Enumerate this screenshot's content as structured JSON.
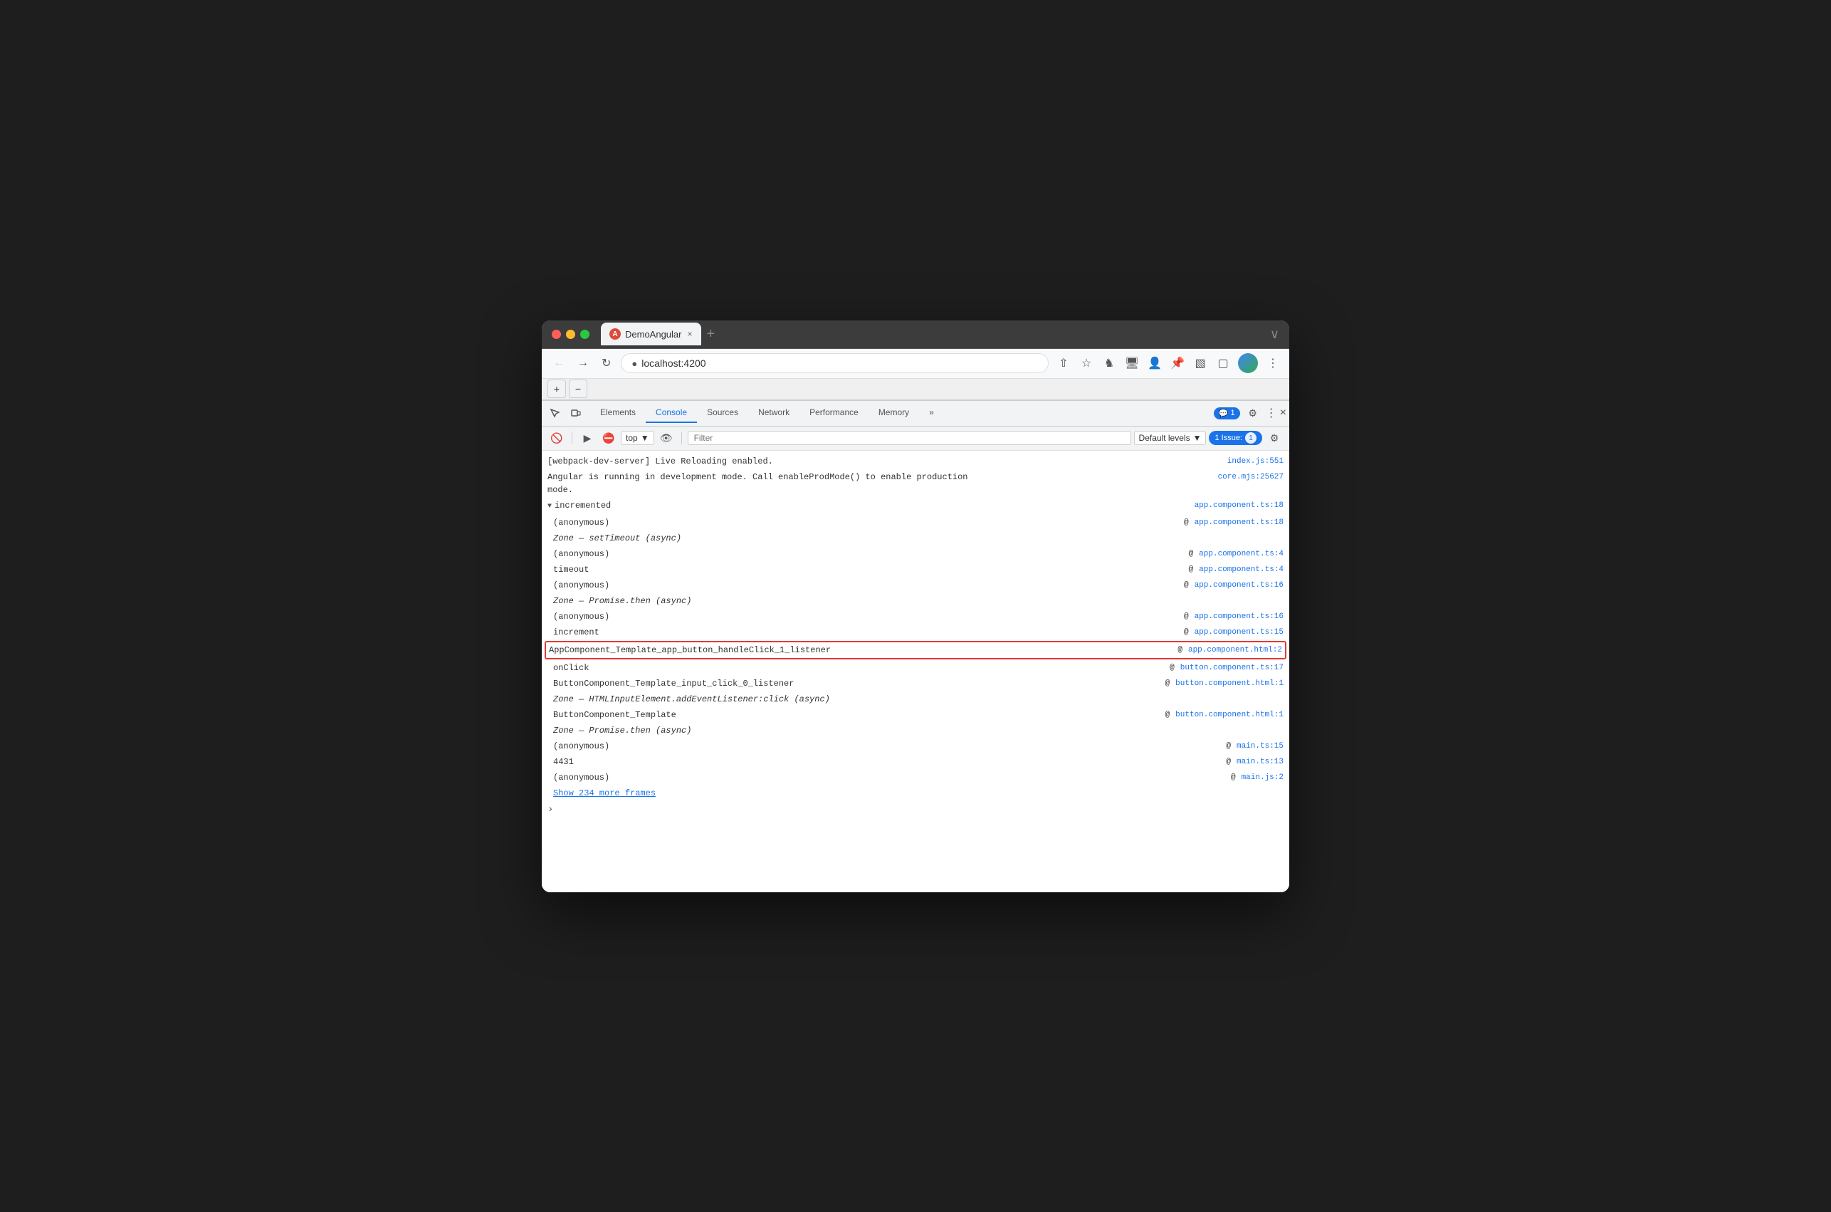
{
  "browser": {
    "tab_title": "DemoAngular",
    "tab_close": "×",
    "tab_new": "+",
    "address": "localhost:4200",
    "window_expand": "∨"
  },
  "devtools": {
    "tabs": [
      "Elements",
      "Console",
      "Sources",
      "Network",
      "Performance",
      "Memory"
    ],
    "active_tab": "Console",
    "more_tabs": "»",
    "badge_count": "1",
    "settings_icon": "⚙",
    "more_icon": "⋮",
    "close_icon": "×"
  },
  "console_toolbar": {
    "clear_icon": "🚫",
    "filter_placeholder": "Filter",
    "context": "top",
    "eye_icon": "👁",
    "levels": "Default levels",
    "levels_arrow": "▼",
    "issue_label": "1 Issue:",
    "issue_count": "1",
    "settings_icon": "⚙"
  },
  "console_lines": [
    {
      "indent": 0,
      "message": "[webpack-dev-server] Live Reloading enabled.",
      "source": "index.js:551",
      "is_link": true
    },
    {
      "indent": 0,
      "message": "Angular is running in development mode. Call enableProdMode() to enable production\nmode.",
      "source": "core.mjs:25627",
      "is_link": true
    },
    {
      "indent": 0,
      "arrow": true,
      "message": "incremented",
      "source": "app.component.ts:18",
      "is_link": true
    },
    {
      "indent": 1,
      "message": "(anonymous)",
      "source_prefix": "@ ",
      "source": "app.component.ts:18",
      "is_link": true
    },
    {
      "indent": 1,
      "message": "Zone — setTimeout (async)",
      "source": "",
      "is_link": false
    },
    {
      "indent": 1,
      "message": "(anonymous)",
      "source_prefix": "@ ",
      "source": "app.component.ts:4",
      "is_link": true
    },
    {
      "indent": 1,
      "message": "timeout",
      "source_prefix": "@ ",
      "source": "app.component.ts:4",
      "is_link": true
    },
    {
      "indent": 1,
      "message": "(anonymous)",
      "source_prefix": "@ ",
      "source": "app.component.ts:16",
      "is_link": true
    },
    {
      "indent": 1,
      "message": "Zone — Promise.then (async)",
      "source": "",
      "is_link": false
    },
    {
      "indent": 1,
      "message": "(anonymous)",
      "source_prefix": "@ ",
      "source": "app.component.ts:16",
      "is_link": true
    },
    {
      "indent": 1,
      "message": "increment",
      "source_prefix": "@ ",
      "source": "app.component.ts:15",
      "is_link": true
    },
    {
      "indent": 1,
      "message": "AppComponent_Template_app_button_handleClick_1_listener",
      "source_prefix": "@ ",
      "source": "app.component.html:2",
      "is_link": true,
      "highlighted": true
    },
    {
      "indent": 1,
      "message": "onClick",
      "source_prefix": "@ ",
      "source": "button.component.ts:17",
      "is_link": true
    },
    {
      "indent": 1,
      "message": "ButtonComponent_Template_input_click_0_listener",
      "source_prefix": "@ ",
      "source": "button.component.html:1",
      "is_link": true
    },
    {
      "indent": 1,
      "message": "Zone — HTMLInputElement.addEventListener:click (async)",
      "source": "",
      "is_link": false
    },
    {
      "indent": 1,
      "message": "ButtonComponent_Template",
      "source_prefix": "@ ",
      "source": "button.component.html:1",
      "is_link": true
    },
    {
      "indent": 1,
      "message": "Zone — Promise.then (async)",
      "source": "",
      "is_link": false
    },
    {
      "indent": 1,
      "message": "(anonymous)",
      "source_prefix": "@ ",
      "source": "main.ts:15",
      "is_link": true
    },
    {
      "indent": 1,
      "message": "4431",
      "source_prefix": "@ ",
      "source": "main.ts:13",
      "is_link": true
    },
    {
      "indent": 1,
      "message": "(anonymous)",
      "source_prefix": "@ ",
      "source": "main.js:2",
      "is_link": true
    }
  ],
  "show_more_frames": "Show 234 more frames"
}
